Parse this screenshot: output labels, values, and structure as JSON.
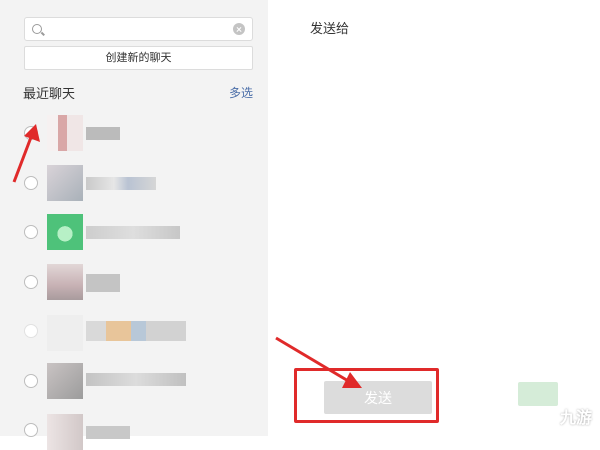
{
  "search": {
    "value": "",
    "placeholder": ""
  },
  "new_chat_label": "创建新的聊天",
  "section_title": "最近聊天",
  "multi_select_label": "多选",
  "right_title": "发送给",
  "send_label": "发送",
  "watermark": "九游",
  "icons": [
    "search-icon",
    "clear-icon",
    "arrow-icon"
  ],
  "colors": {
    "accent_link": "#4b6ea8",
    "annotation_red": "#e02a2a",
    "disabled_button": "#dcdcdc"
  }
}
